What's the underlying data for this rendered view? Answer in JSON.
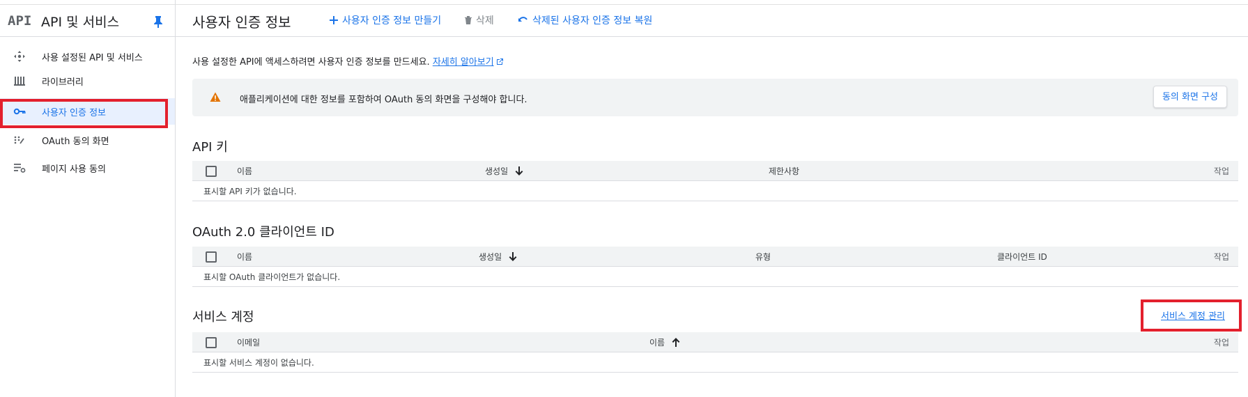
{
  "sidebar": {
    "logo": "API",
    "title": "API 및 서비스",
    "items": [
      {
        "label": "사용 설정된 API 및 서비스",
        "icon": "enabled-apis-icon"
      },
      {
        "label": "라이브러리",
        "icon": "library-icon"
      },
      {
        "label": "사용자 인증 정보",
        "icon": "key-icon",
        "active": true
      },
      {
        "label": "OAuth 동의 화면",
        "icon": "oauth-consent-icon"
      },
      {
        "label": "페이지 사용 동의",
        "icon": "page-usage-icon"
      }
    ]
  },
  "header": {
    "title": "사용자 인증 정보",
    "create_label": "사용자 인증 정보 만들기",
    "delete_label": "삭제",
    "restore_label": "삭제된 사용자 인증 정보 복원"
  },
  "intro": {
    "text": "사용 설정한 API에 액세스하려면 사용자 인증 정보를 만드세요.",
    "link": "자세히 알아보기"
  },
  "banner": {
    "message": "애플리케이션에 대한 정보를 포함하여 OAuth 동의 화면을 구성해야 합니다.",
    "button": "동의 화면 구성"
  },
  "api_keys": {
    "title": "API 키",
    "columns": [
      "이름",
      "생성일",
      "제한사항",
      "작업"
    ],
    "empty": "표시할 API 키가 없습니다."
  },
  "oauth": {
    "title": "OAuth 2.0 클라이언트 ID",
    "columns": [
      "이름",
      "생성일",
      "유형",
      "클라이언트 ID",
      "작업"
    ],
    "empty": "표시할 OAuth 클라이언트가 없습니다."
  },
  "service_accounts": {
    "title": "서비스 계정",
    "manage_link": "서비스 계정 관리",
    "columns": [
      "이메일",
      "이름",
      "작업"
    ],
    "empty": "표시할 서비스 계정이 없습니다."
  },
  "colors": {
    "accent": "#1a73e8",
    "highlight": "#e3202d",
    "warning": "#e37400"
  }
}
